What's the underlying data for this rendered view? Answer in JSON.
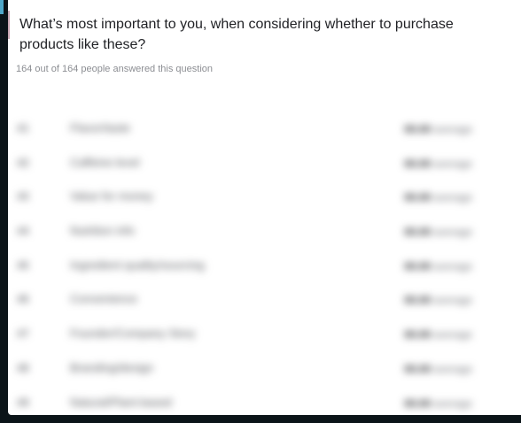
{
  "question": {
    "title": "What’s most important to you, when considering whether to purchase products like these?",
    "response_count": "164 out of 164 people answered this question"
  },
  "results": [
    {
      "rank": "#1",
      "label": "Flavor/taste",
      "score": "00.00",
      "unit": "average"
    },
    {
      "rank": "#2",
      "label": "Caffeine level",
      "score": "00.00",
      "unit": "average"
    },
    {
      "rank": "#3",
      "label": "Value for money",
      "score": "00.00",
      "unit": "average"
    },
    {
      "rank": "#4",
      "label": "Nutrition info",
      "score": "00.00",
      "unit": "average"
    },
    {
      "rank": "#5",
      "label": "Ingredient quality/sourcing",
      "score": "00.00",
      "unit": "average"
    },
    {
      "rank": "#6",
      "label": "Convenience",
      "score": "00.00",
      "unit": "average"
    },
    {
      "rank": "#7",
      "label": "Founder/Company Story",
      "score": "00.00",
      "unit": "average"
    },
    {
      "rank": "#8",
      "label": "Branding/design",
      "score": "00.00",
      "unit": "average"
    },
    {
      "rank": "#9",
      "label": "Natural/Plant-based",
      "score": "00.00",
      "unit": "average"
    }
  ]
}
